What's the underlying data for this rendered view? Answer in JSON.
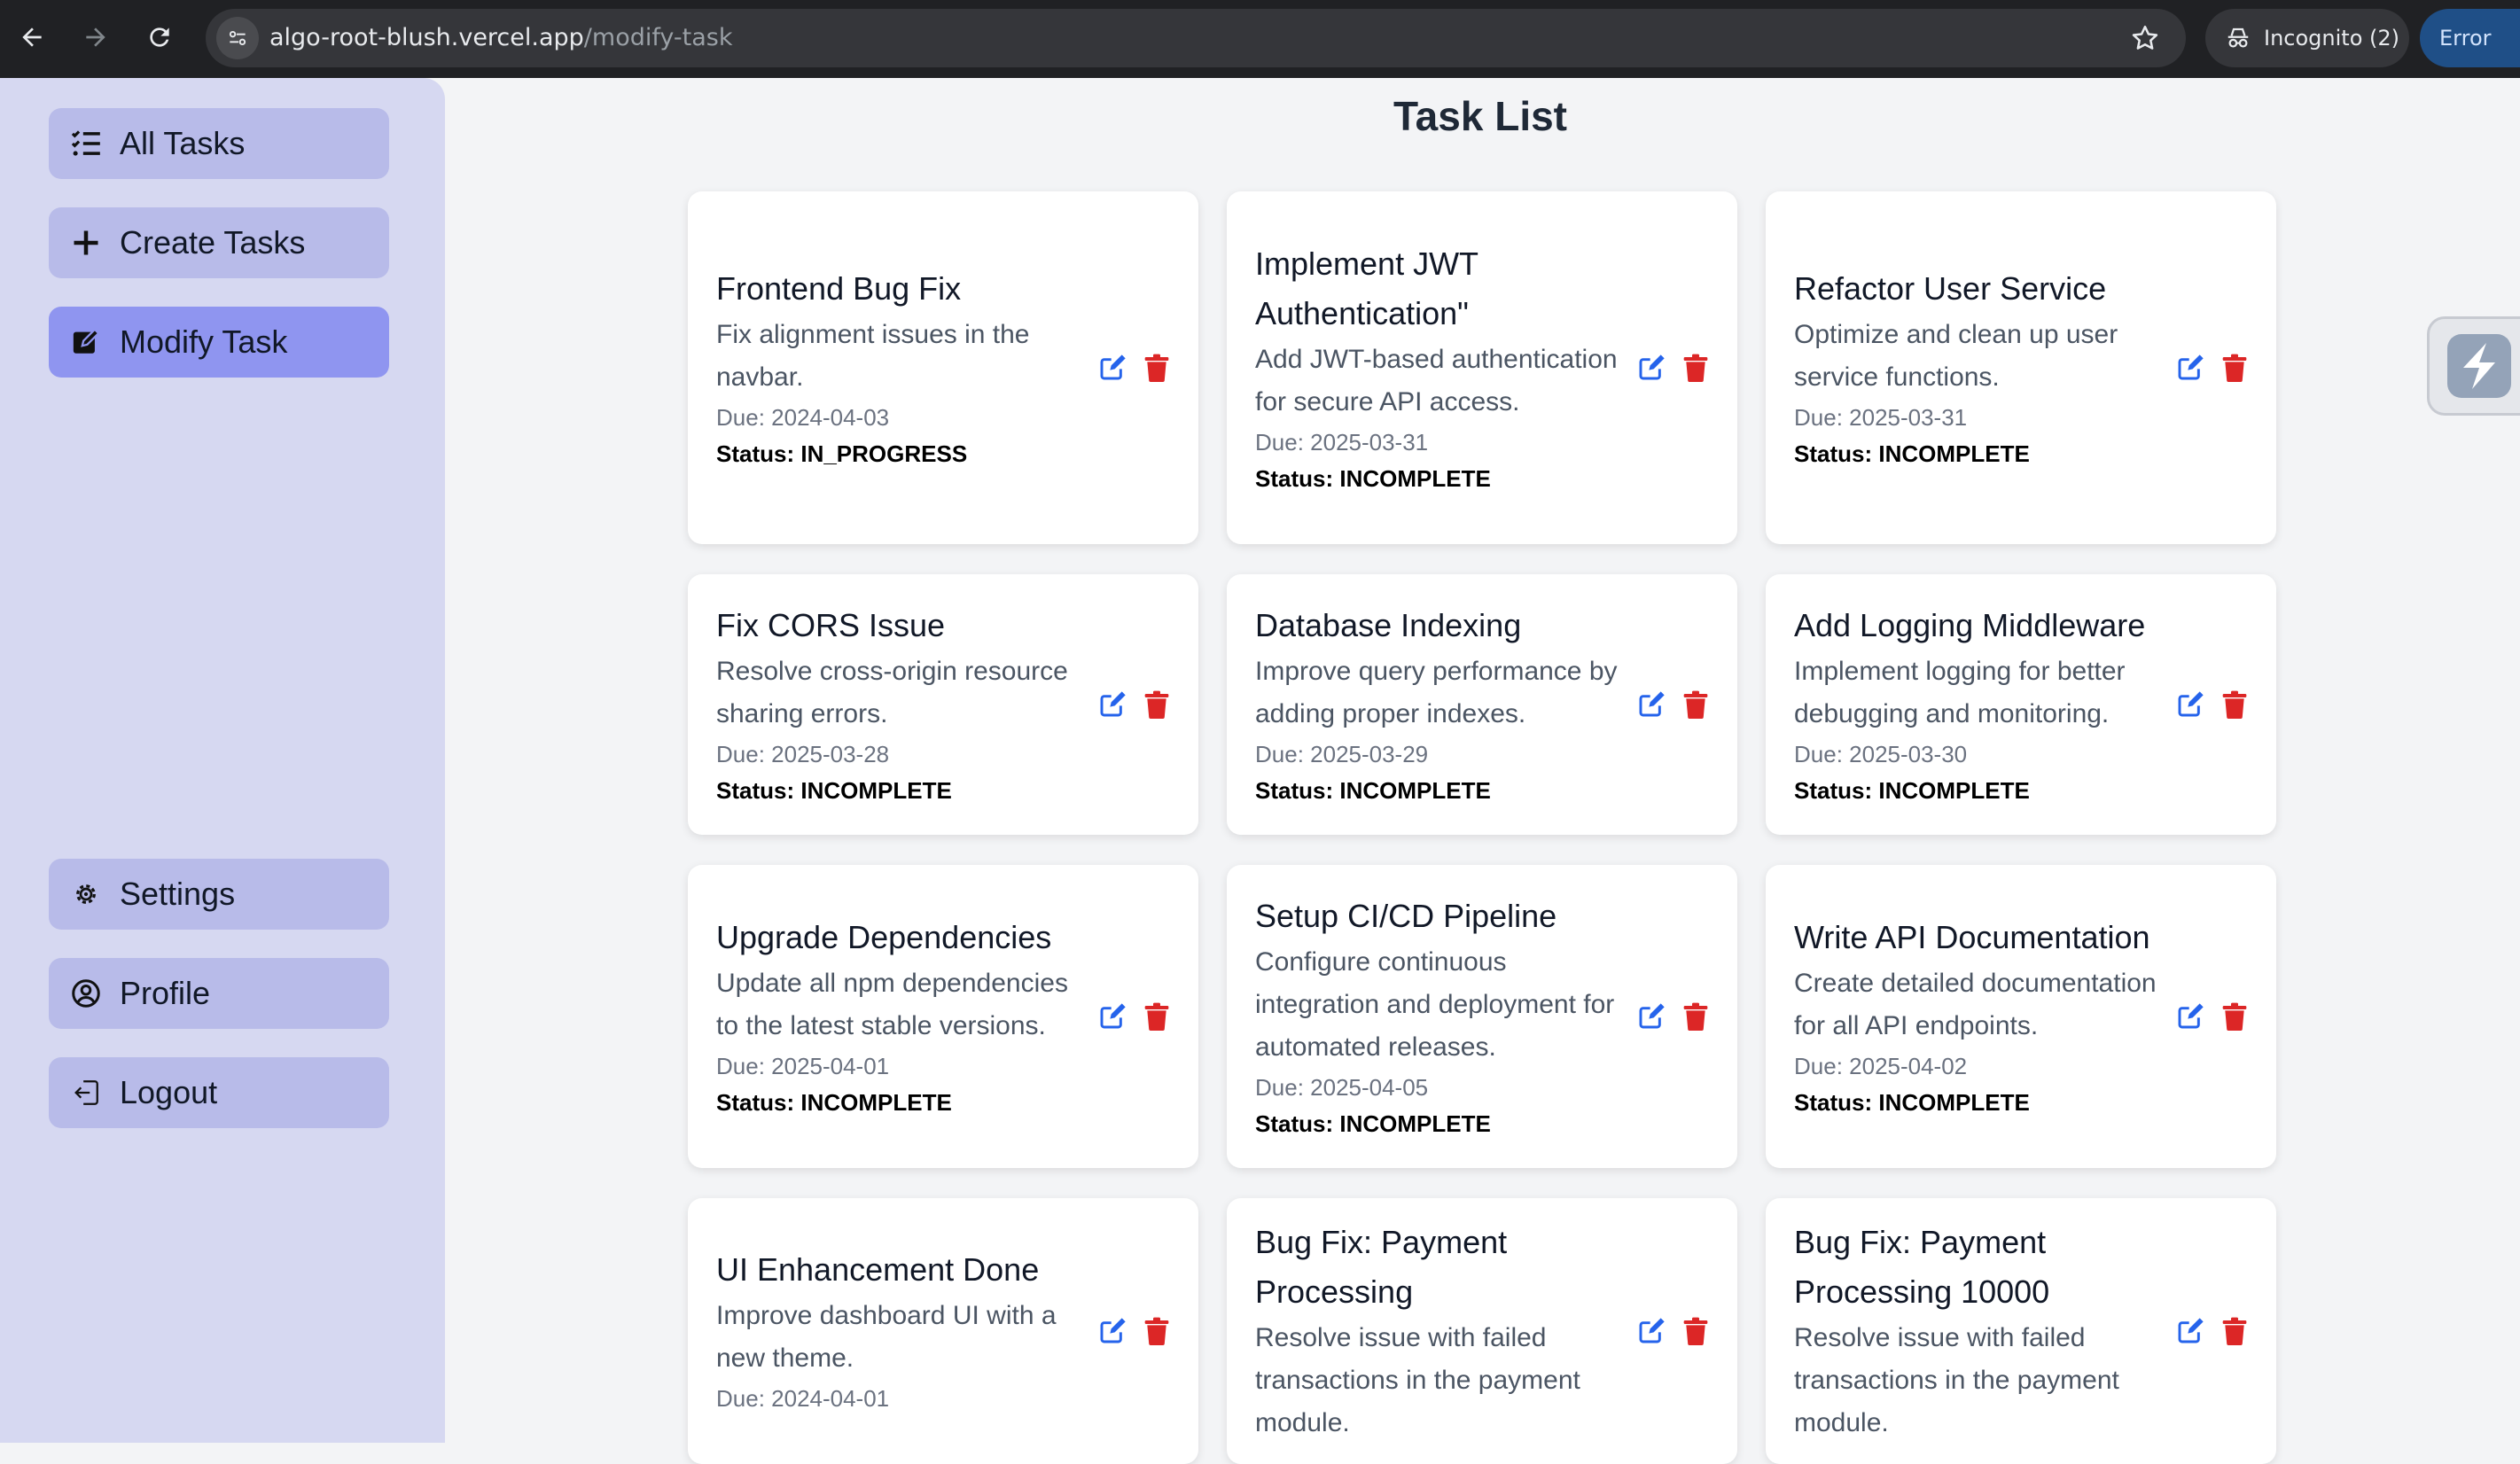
{
  "browser": {
    "url_host": "algo-root-blush.vercel.app",
    "url_path": "/modify-task",
    "incognito_label": "Incognito (2)",
    "error_label": "Error",
    "icons": [
      "back-arrow-icon",
      "forward-arrow-icon",
      "reload-icon",
      "site-info-icon",
      "star-icon",
      "incognito-icon",
      "more-vert-icon"
    ]
  },
  "sidebar": {
    "top_items": [
      {
        "label": "All Tasks",
        "icon": "list-check-icon"
      },
      {
        "label": "Create Tasks",
        "icon": "plus-icon"
      },
      {
        "label": "Modify Task",
        "icon": "edit-square-icon",
        "active": true
      }
    ],
    "bottom_items": [
      {
        "label": "Settings",
        "icon": "gear-icon"
      },
      {
        "label": "Profile",
        "icon": "user-circle-icon"
      },
      {
        "label": "Logout",
        "icon": "logout-icon"
      }
    ],
    "active_color": "#8f95f0",
    "item_color": "#b8bbe9"
  },
  "main": {
    "title": "Task List",
    "tasks": [
      {
        "title": "Frontend Bug Fix",
        "description": "Fix alignment issues in the navbar.",
        "due": "Due: 2024-04-03",
        "status": "Status: IN_PROGRESS"
      },
      {
        "title": "Implement JWT Authentication\"",
        "description": "Add JWT-based authentication for secure API access.",
        "due": "Due: 2025-03-31",
        "status": "Status: INCOMPLETE"
      },
      {
        "title": "Refactor User Service",
        "description": "Optimize and clean up user service functions.",
        "due": "Due: 2025-03-31",
        "status": "Status: INCOMPLETE"
      },
      {
        "title": "Fix CORS Issue",
        "description": "Resolve cross-origin resource sharing errors.",
        "due": "Due: 2025-03-28",
        "status": "Status: INCOMPLETE"
      },
      {
        "title": "Database Indexing",
        "description": "Improve query performance by adding proper indexes.",
        "due": "Due: 2025-03-29",
        "status": "Status: INCOMPLETE"
      },
      {
        "title": "Add Logging Middleware",
        "description": "Implement logging for better debugging and monitoring.",
        "due": "Due: 2025-03-30",
        "status": "Status: INCOMPLETE"
      },
      {
        "title": "Upgrade Dependencies",
        "description": "Update all npm dependencies to the latest stable versions.",
        "due": "Due: 2025-04-01",
        "status": "Status: INCOMPLETE"
      },
      {
        "title": "Setup CI/CD Pipeline",
        "description": "Configure continuous integration and deployment for automated releases.",
        "due": "Due: 2025-04-05",
        "status": "Status: INCOMPLETE"
      },
      {
        "title": "Write API Documentation",
        "description": "Create detailed documentation for all API endpoints.",
        "due": "Due: 2025-04-02",
        "status": "Status: INCOMPLETE"
      },
      {
        "title": "UI Enhancement Done",
        "description": "Improve dashboard UI with a new theme.",
        "due": "Due: 2024-04-01",
        "status": ""
      },
      {
        "title": "Bug Fix: Payment Processing",
        "description": "Resolve issue with failed transactions in the payment module.",
        "due": "",
        "status": ""
      },
      {
        "title": "Bug Fix: Payment Processing 10000",
        "description": "Resolve issue with failed transactions in the payment module.",
        "due": "",
        "status": ""
      }
    ],
    "edit_icon_color": "#2563eb",
    "delete_icon_color": "#dc2626"
  }
}
